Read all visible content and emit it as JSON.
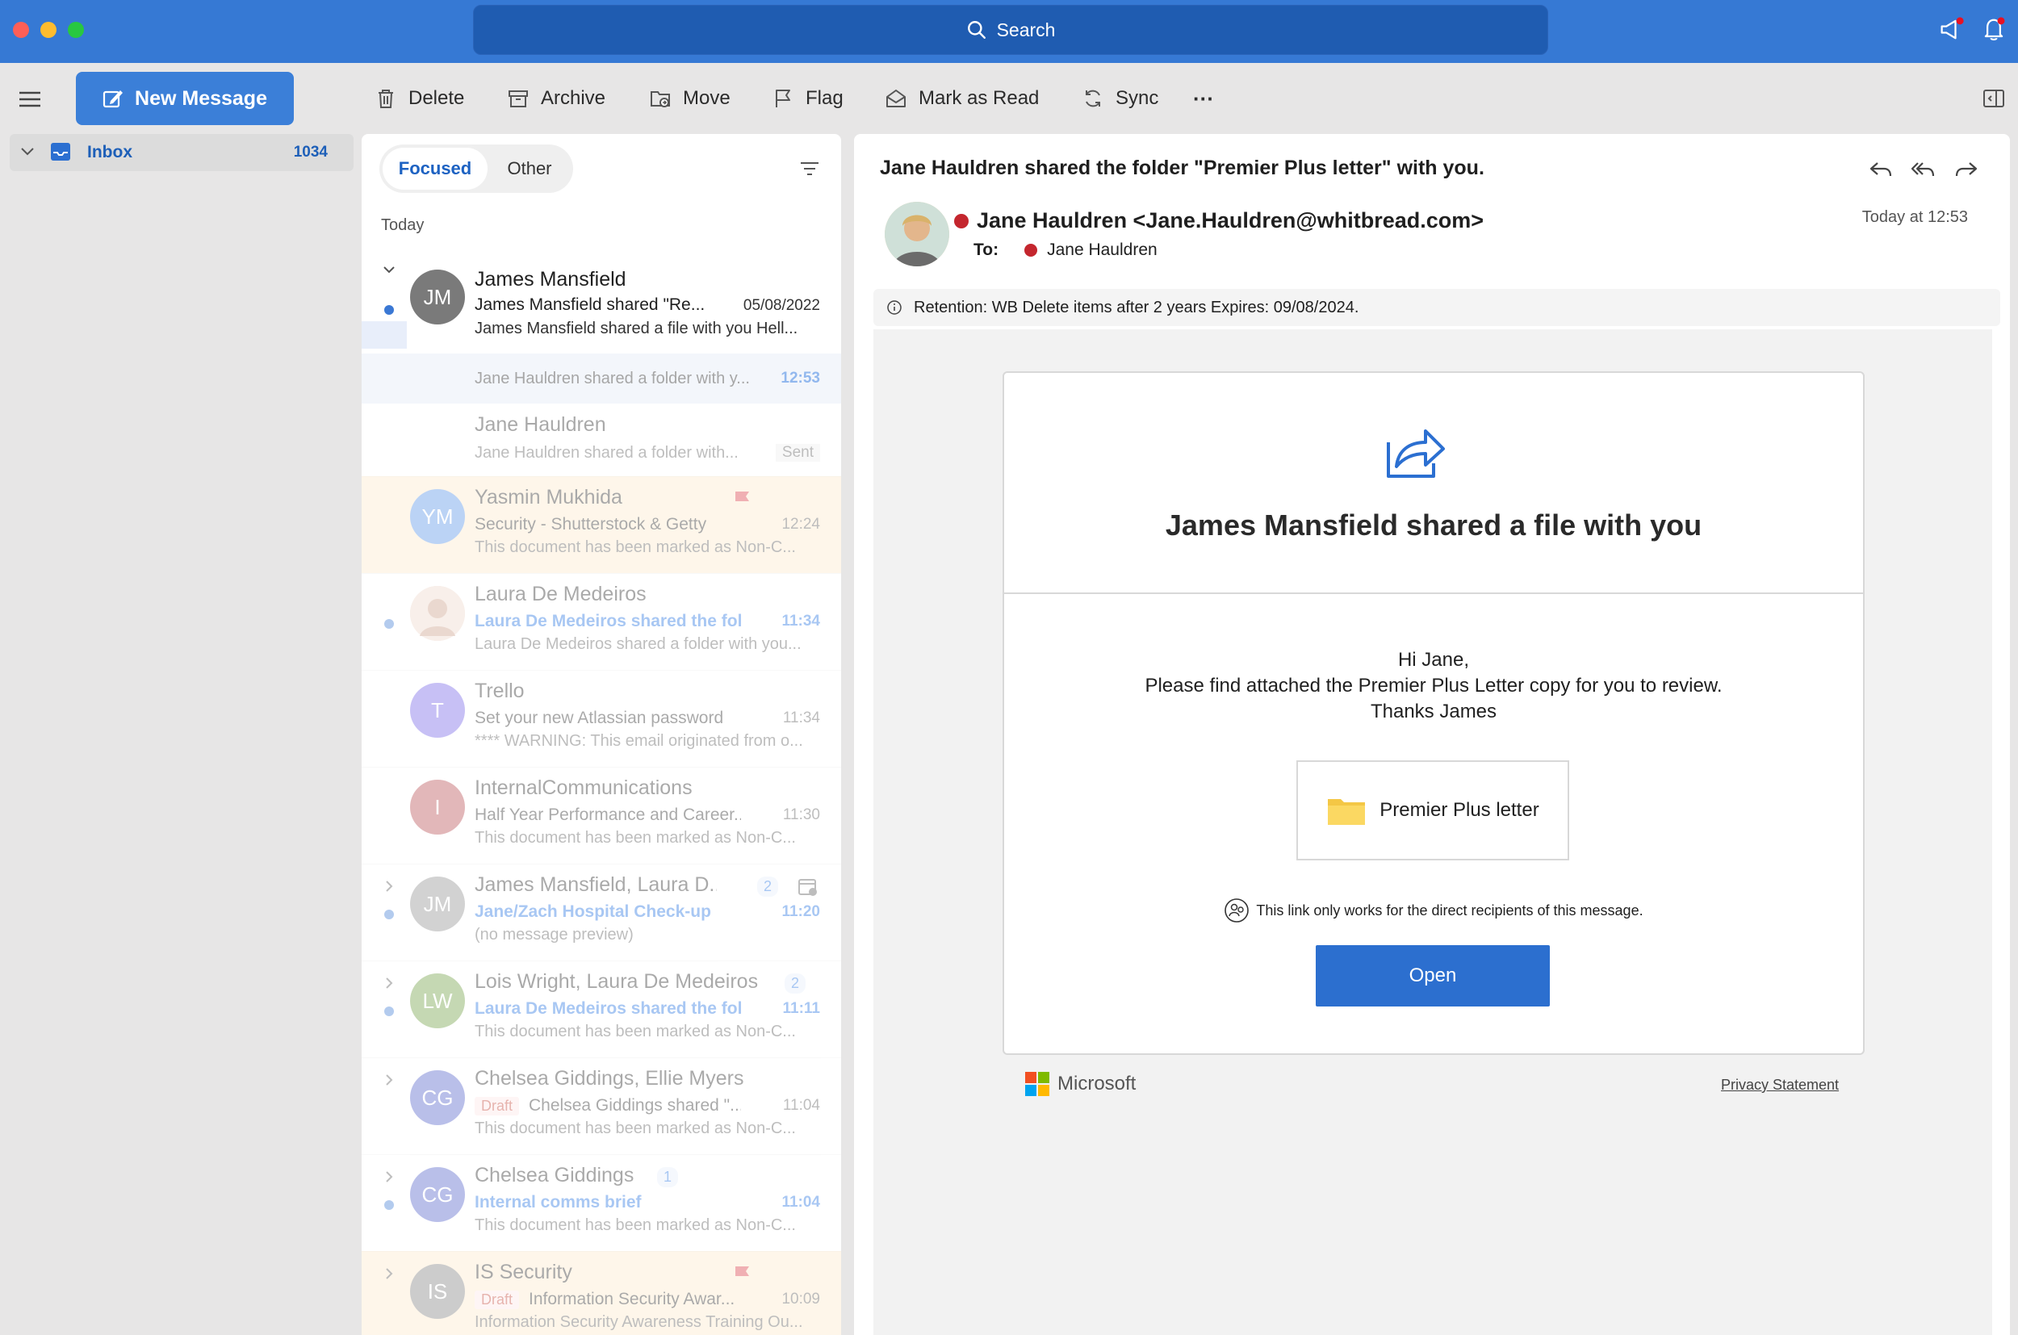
{
  "titlebar": {
    "search_label": "Search"
  },
  "toolbar": {
    "new_message": "New Message",
    "delete": "Delete",
    "archive": "Archive",
    "move": "Move",
    "flag": "Flag",
    "mark_as_read": "Mark as Read",
    "sync": "Sync",
    "more": "···"
  },
  "folders": {
    "inbox_label": "Inbox",
    "inbox_count": "1034"
  },
  "list": {
    "tab_focused": "Focused",
    "tab_other": "Other",
    "group_today": "Today",
    "messages": [
      {
        "sender": "James Mansfield",
        "subject": "James Mansfield shared \"Re...",
        "preview": "James Mansfield shared a file with you Hell...",
        "time": "05/08/2022",
        "initials": "JM"
      },
      {
        "sender": "",
        "subject": "",
        "preview": "Jane Hauldren shared a folder with y...",
        "time": "12:53"
      },
      {
        "sender": "Jane Hauldren",
        "subject": "",
        "preview": "Jane Hauldren shared a folder with...",
        "time": "Sent"
      },
      {
        "sender": "Yasmin Mukhida",
        "subject": "Security - Shutterstock & Getty",
        "preview": "This document has been marked as Non-C...",
        "time": "12:24",
        "initials": "YM"
      },
      {
        "sender": "Laura De Medeiros",
        "subject": "Laura De Medeiros shared the fol...",
        "preview": "Laura De Medeiros shared a folder with you...",
        "time": "11:34"
      },
      {
        "sender": "Trello",
        "subject": "Set your new Atlassian password",
        "preview": "**** WARNING: This email originated from o...",
        "time": "11:34",
        "initials": "T"
      },
      {
        "sender": "InternalCommunications",
        "subject": "Half Year Performance and Career...",
        "preview": "This document has been marked as Non-C...",
        "time": "11:30",
        "initials": "I"
      },
      {
        "sender": "James Mansfield, Laura D...",
        "subject": "Jane/Zach Hospital Check-up",
        "preview": "(no message preview)",
        "time": "11:20",
        "initials": "JM",
        "count": "2"
      },
      {
        "sender": "Lois Wright, Laura De Medeiros",
        "subject": "Laura De Medeiros shared the fol...",
        "preview": "This document has been marked as Non-C...",
        "time": "11:11",
        "initials": "LW",
        "count": "2"
      },
      {
        "sender": "Chelsea Giddings, Ellie Myers",
        "draft": "Draft",
        "subject": "Chelsea Giddings shared \"...",
        "preview": "This document has been marked as Non-C...",
        "time": "11:04",
        "initials": "CG"
      },
      {
        "sender": "Chelsea Giddings",
        "subject": "Internal comms brief",
        "preview": "This document has been marked as Non-C...",
        "time": "11:04",
        "initials": "CG",
        "count": "1"
      },
      {
        "sender": "IS Security",
        "draft": "Draft",
        "subject": "Information Security Awar...",
        "preview": "Information Security Awareness Training Ou...",
        "time": "10:09",
        "initials": "IS"
      }
    ]
  },
  "reading": {
    "subject": "Jane Hauldren shared the folder \"Premier Plus letter\" with you.",
    "from": "Jane Hauldren <Jane.Hauldren@whitbread.com>",
    "to_label": "To:",
    "to_name": "Jane Hauldren",
    "date": "Today at 12:53",
    "retention": "Retention: WB Delete items after 2 years Expires: 09/08/2024.",
    "card_title": "James Mansfield shared a file with you",
    "greeting_1": "Hi Jane,",
    "greeting_2": "Please find attached the Premier Plus Letter copy for you to review.",
    "greeting_3": "Thanks James",
    "folder_name": "Premier Plus letter",
    "link_note": "This link only works for the direct recipients of this message.",
    "open_button": "Open",
    "ms_brand": "Microsoft",
    "privacy": "Privacy Statement"
  },
  "colors": {
    "titlebar": "#3679d4",
    "accent": "#3b7fd8",
    "unread_blue": "#1d6fe0",
    "presence_busy": "#c4262e"
  }
}
